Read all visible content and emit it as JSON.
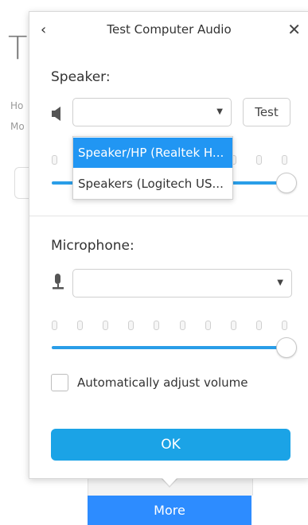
{
  "background": {
    "title_fragment": "T",
    "line1": "Ho",
    "line2": "Mo",
    "more_button": "More"
  },
  "dialog": {
    "title": "Test Computer Audio",
    "back_label": "‹",
    "close_label": "✕",
    "speaker": {
      "label": "Speaker:",
      "selected_value": "",
      "test_button": "Test",
      "volume": 1.0,
      "options": [
        "Speaker/HP (Realtek H...",
        "Speakers (Logitech US..."
      ]
    },
    "microphone": {
      "label": "Microphone:",
      "selected_value": "",
      "volume": 1.0
    },
    "auto_adjust": {
      "label": "Automatically adjust volume",
      "checked": false
    },
    "ok_button": "OK"
  },
  "colors": {
    "accent": "#1ba3e6",
    "slider_fill": "#2a9ee8",
    "selected_option": "#2196f3",
    "more_button": "#2d8cff"
  }
}
